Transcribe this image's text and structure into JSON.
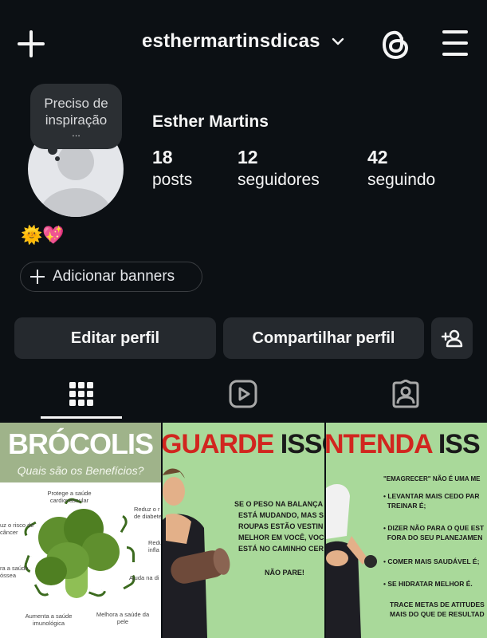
{
  "header": {
    "username": "esthermartinsdicas",
    "create_icon": "plus-icon",
    "dropdown_icon": "chevron-down-icon",
    "threads_icon": "threads-icon",
    "menu_icon": "hamburger-menu-icon"
  },
  "profile": {
    "note_line1": "Preciso de",
    "note_line2": "inspiração",
    "note_dots": "...",
    "display_name": "Esther Martins",
    "bio": "🌞💖",
    "stats": [
      {
        "value": "18",
        "label": "posts"
      },
      {
        "value": "12",
        "label": "seguidores"
      },
      {
        "value": "42",
        "label": "seguindo"
      }
    ],
    "add_banners_label": "Adicionar banners"
  },
  "actions": {
    "edit_label": "Editar perfil",
    "share_label": "Compartilhar perfil",
    "add_person_icon": "add-person-icon"
  },
  "tabs": [
    {
      "icon": "grid-icon",
      "active": true
    },
    {
      "icon": "reels-icon",
      "active": false
    },
    {
      "icon": "tagged-icon",
      "active": false
    }
  ],
  "posts": [
    {
      "title": "BRÓCOLIS",
      "subtitle": "Quais são os Benefícios?",
      "labels": [
        "Protege a saúde\ncardiovascular",
        "Reduz o r\nde diabete",
        "uz o risco de\ncâncer",
        "Redu\ninfla",
        "ra a saúde\nóssea",
        "Ajuda na di",
        "Aumenta a saúde\nimunológica",
        "Melhora a saúde da\npele"
      ]
    },
    {
      "title_part1": "GUARDE",
      "title_part2": " ISSO.",
      "lines": [
        "SE O PESO NA BALANÇA",
        "ESTÁ MUDANDO, MAS S",
        "ROUPAS ESTÃO VESTIN",
        "MELHOR EM VOCÊ, VOC",
        "ESTÁ NO CAMINHO CER",
        "",
        "NÃO PARE!"
      ]
    },
    {
      "title_part1": "NTENDA",
      "title_part2": " ISS",
      "lines": [
        "\"EMAGRECER\" NÃO É UMA ME",
        "",
        "• LEVANTAR MAIS CEDO PAR",
        "  TREINAR É;",
        "",
        "• DIZER NÃO PARA O QUE EST",
        "  FORA DO SEU PLANEJAMEN",
        "",
        "• COMER MAIS SAUDÁVEL É;",
        "",
        "• SE HIDRATAR MELHOR É.",
        "",
        "TRACE METAS DE ATITUDES",
        "MAIS DO QUE DE RESULTAD"
      ]
    }
  ],
  "colors": {
    "background": "#0c1014",
    "button_bg": "#25292e",
    "text": "#f5f5f5",
    "accent_red": "#d1261f",
    "post_green": "#a9d99a"
  }
}
